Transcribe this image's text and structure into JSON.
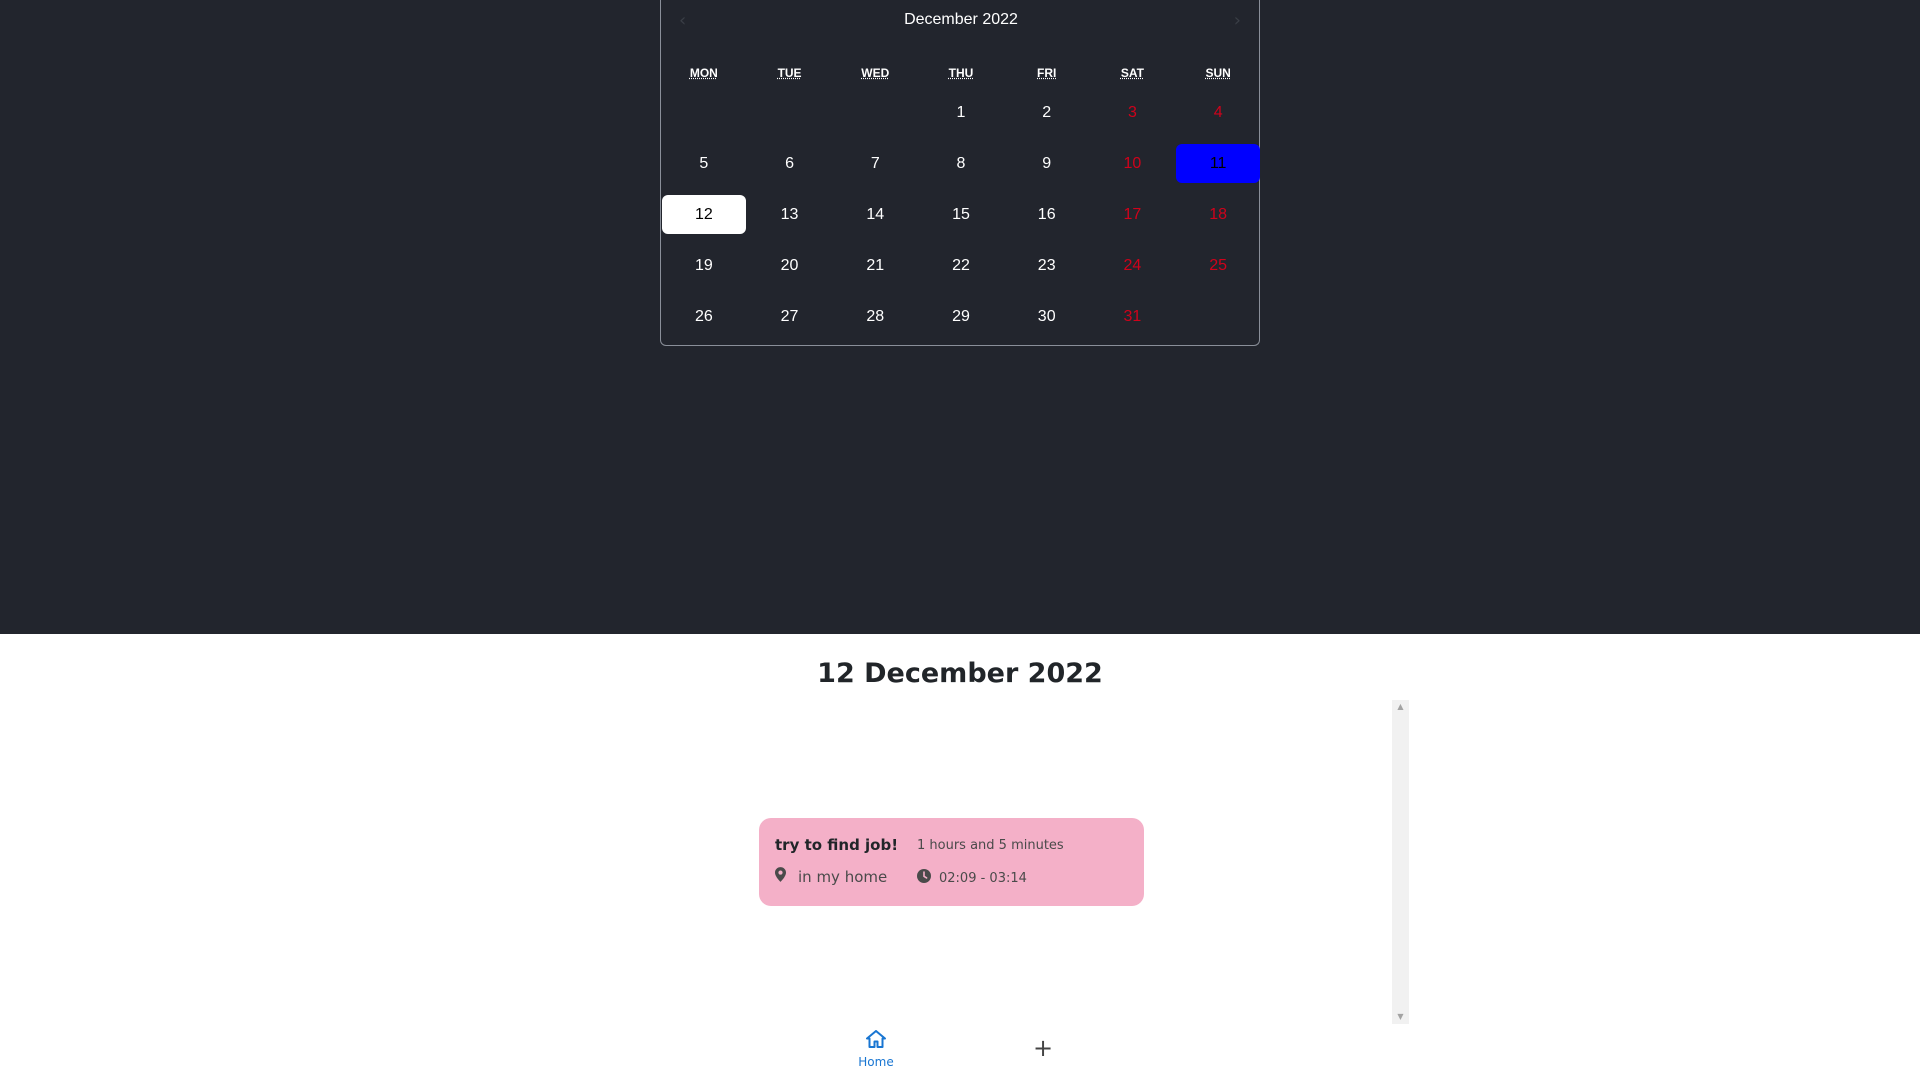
{
  "calendar": {
    "title": "December 2022",
    "prev_symbol": "‹",
    "next_symbol": "›",
    "weekdays": [
      "MON",
      "TUE",
      "WED",
      "THU",
      "FRI",
      "SAT",
      "SUN"
    ],
    "days": [
      {
        "label": "",
        "weekend": false,
        "state": "empty"
      },
      {
        "label": "",
        "weekend": false,
        "state": "empty"
      },
      {
        "label": "",
        "weekend": false,
        "state": "empty"
      },
      {
        "label": "1",
        "weekend": false,
        "state": ""
      },
      {
        "label": "2",
        "weekend": false,
        "state": ""
      },
      {
        "label": "3",
        "weekend": true,
        "state": ""
      },
      {
        "label": "4",
        "weekend": true,
        "state": ""
      },
      {
        "label": "5",
        "weekend": false,
        "state": ""
      },
      {
        "label": "6",
        "weekend": false,
        "state": ""
      },
      {
        "label": "7",
        "weekend": false,
        "state": ""
      },
      {
        "label": "8",
        "weekend": false,
        "state": ""
      },
      {
        "label": "9",
        "weekend": false,
        "state": ""
      },
      {
        "label": "10",
        "weekend": true,
        "state": ""
      },
      {
        "label": "11",
        "weekend": true,
        "state": "today"
      },
      {
        "label": "12",
        "weekend": false,
        "state": "selected"
      },
      {
        "label": "13",
        "weekend": false,
        "state": ""
      },
      {
        "label": "14",
        "weekend": false,
        "state": ""
      },
      {
        "label": "15",
        "weekend": false,
        "state": ""
      },
      {
        "label": "16",
        "weekend": false,
        "state": ""
      },
      {
        "label": "17",
        "weekend": true,
        "state": ""
      },
      {
        "label": "18",
        "weekend": true,
        "state": ""
      },
      {
        "label": "19",
        "weekend": false,
        "state": ""
      },
      {
        "label": "20",
        "weekend": false,
        "state": ""
      },
      {
        "label": "21",
        "weekend": false,
        "state": ""
      },
      {
        "label": "22",
        "weekend": false,
        "state": ""
      },
      {
        "label": "23",
        "weekend": false,
        "state": ""
      },
      {
        "label": "24",
        "weekend": true,
        "state": ""
      },
      {
        "label": "25",
        "weekend": true,
        "state": ""
      },
      {
        "label": "26",
        "weekend": false,
        "state": ""
      },
      {
        "label": "27",
        "weekend": false,
        "state": ""
      },
      {
        "label": "28",
        "weekend": false,
        "state": ""
      },
      {
        "label": "29",
        "weekend": false,
        "state": ""
      },
      {
        "label": "30",
        "weekend": false,
        "state": ""
      },
      {
        "label": "31",
        "weekend": true,
        "state": ""
      }
    ]
  },
  "selected_date_heading": "12 December 2022",
  "event": {
    "title": "try to find job!",
    "duration": "1 hours and 5 minutes",
    "location": "in my home",
    "time_range": "02:09 - 03:14",
    "location_icon": "map-pin-icon",
    "time_icon": "clock-icon"
  },
  "nav": {
    "home_label": "Home",
    "home_icon": "home-icon",
    "add_symbol": "+"
  },
  "scrollbar": {
    "up_arrow": "▲",
    "down_arrow": "▼"
  },
  "colors": {
    "page_dark_bg": "#22252d",
    "weekend_text": "#d0021b",
    "today_bg": "#0000ff",
    "selected_bg": "#ffffff",
    "event_card_bg": "#f4b0c8",
    "nav_active": "#1976d2"
  }
}
